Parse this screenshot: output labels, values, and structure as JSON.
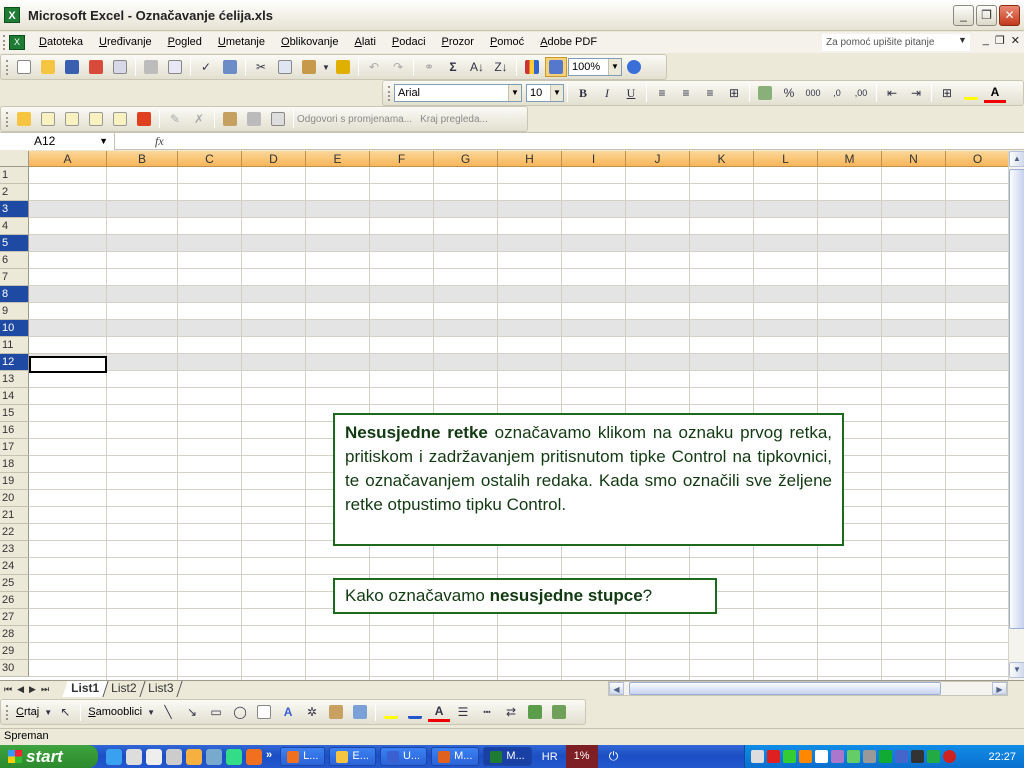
{
  "window": {
    "title": "Microsoft Excel - Označavanje ćelija.xls",
    "app_icon": "X"
  },
  "menu": {
    "items": [
      "Datoteka",
      "Uređivanje",
      "Pogled",
      "Umetanje",
      "Oblikovanje",
      "Alati",
      "Podaci",
      "Prozor",
      "Pomoć",
      "Adobe PDF"
    ],
    "help_placeholder": "Za pomoć upišite pitanje"
  },
  "toolbar": {
    "zoom": "100%",
    "font": "Arial",
    "size": "10"
  },
  "review_toolbar": {
    "reply": "Odgovori s promjenama...",
    "end": "Kraj pregleda..."
  },
  "formula": {
    "namebox": "A12",
    "fx": "fx"
  },
  "columns": [
    "A",
    "B",
    "C",
    "D",
    "E",
    "F",
    "G",
    "H",
    "I",
    "J",
    "K",
    "L",
    "M",
    "N",
    "O"
  ],
  "rows": [
    "1",
    "2",
    "3",
    "4",
    "5",
    "6",
    "7",
    "8",
    "9",
    "10",
    "11",
    "12",
    "13",
    "14",
    "15",
    "16",
    "17",
    "18",
    "19",
    "20",
    "21",
    "22",
    "23",
    "24",
    "25",
    "26",
    "27",
    "28",
    "29",
    "30"
  ],
  "selected_rows": [
    "3",
    "5",
    "8",
    "10",
    "12"
  ],
  "callout1": {
    "bold": "Nesusjedne retke",
    "text": " označavamo klikom na oznaku prvog retka, pritiskom i zadržavanjem pritisnutom tipke Control na tipkovnici, te označavanjem ostalih redaka. Kada smo označili sve željene retke otpustimo tipku Control."
  },
  "callout2": {
    "prefix": "Kako označavamo ",
    "bold": "nesusjedne stupce",
    "suffix": "?"
  },
  "sheets": [
    "List1",
    "List2",
    "List3"
  ],
  "drawing": {
    "draw": "Crtaj",
    "autoshapes": "Samooblici"
  },
  "status": "Spreman",
  "taskbar": {
    "start": "start",
    "buttons": [
      "L...",
      "E...",
      "U...",
      "M...",
      "M..."
    ],
    "lang": "HR",
    "cpu": "1%",
    "time": "22:27"
  },
  "colors": {
    "header": "#f7b65a",
    "selection": "#1f4aa3",
    "callout_border": "#1c6b1c"
  }
}
